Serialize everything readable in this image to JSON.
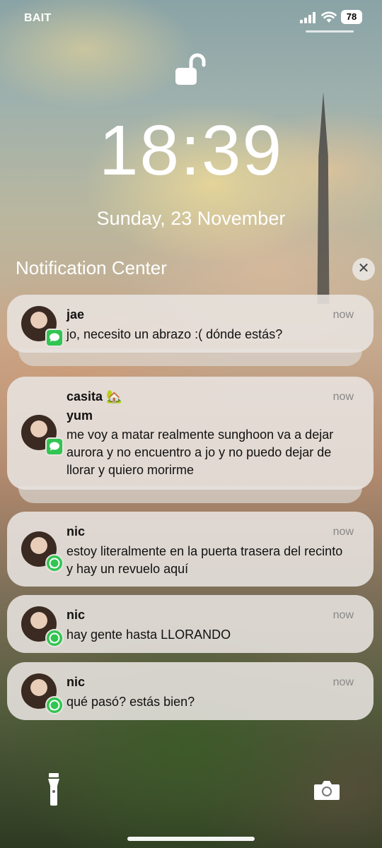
{
  "status_bar": {
    "carrier": "BAIT",
    "battery": "78"
  },
  "lock_screen": {
    "time": "18:39",
    "date": "Sunday, 23 November"
  },
  "notification_center": {
    "title": "Notification Center",
    "close_label": "✕"
  },
  "notifications": [
    {
      "sender": "jae",
      "time": "now",
      "body": "jo, necesito un abrazo :( dónde estás?",
      "app": "messages-icon"
    },
    {
      "sender": "casita 🏡",
      "subsender": "yum",
      "time": "now",
      "body": "me voy a matar realmente sunghoon va a dejar aurora y no encuentro a jo y no puedo dejar de llorar y quiero morirme",
      "app": "messages-icon"
    },
    {
      "sender": "nic",
      "time": "now",
      "body": "estoy literalmente en la puerta trasera del recinto y hay un revuelo aquí",
      "app": "whatsapp-icon"
    },
    {
      "sender": "nic",
      "time": "now",
      "body": "hay gente hasta LLORANDO",
      "app": "whatsapp-icon"
    },
    {
      "sender": "nic",
      "time": "now",
      "body": "qué pasó? estás bien?",
      "app": "whatsapp-icon"
    }
  ],
  "colors": {
    "app_green": "#31c552",
    "card_bg": "#e8e4e0",
    "timestamp": "#888888"
  }
}
